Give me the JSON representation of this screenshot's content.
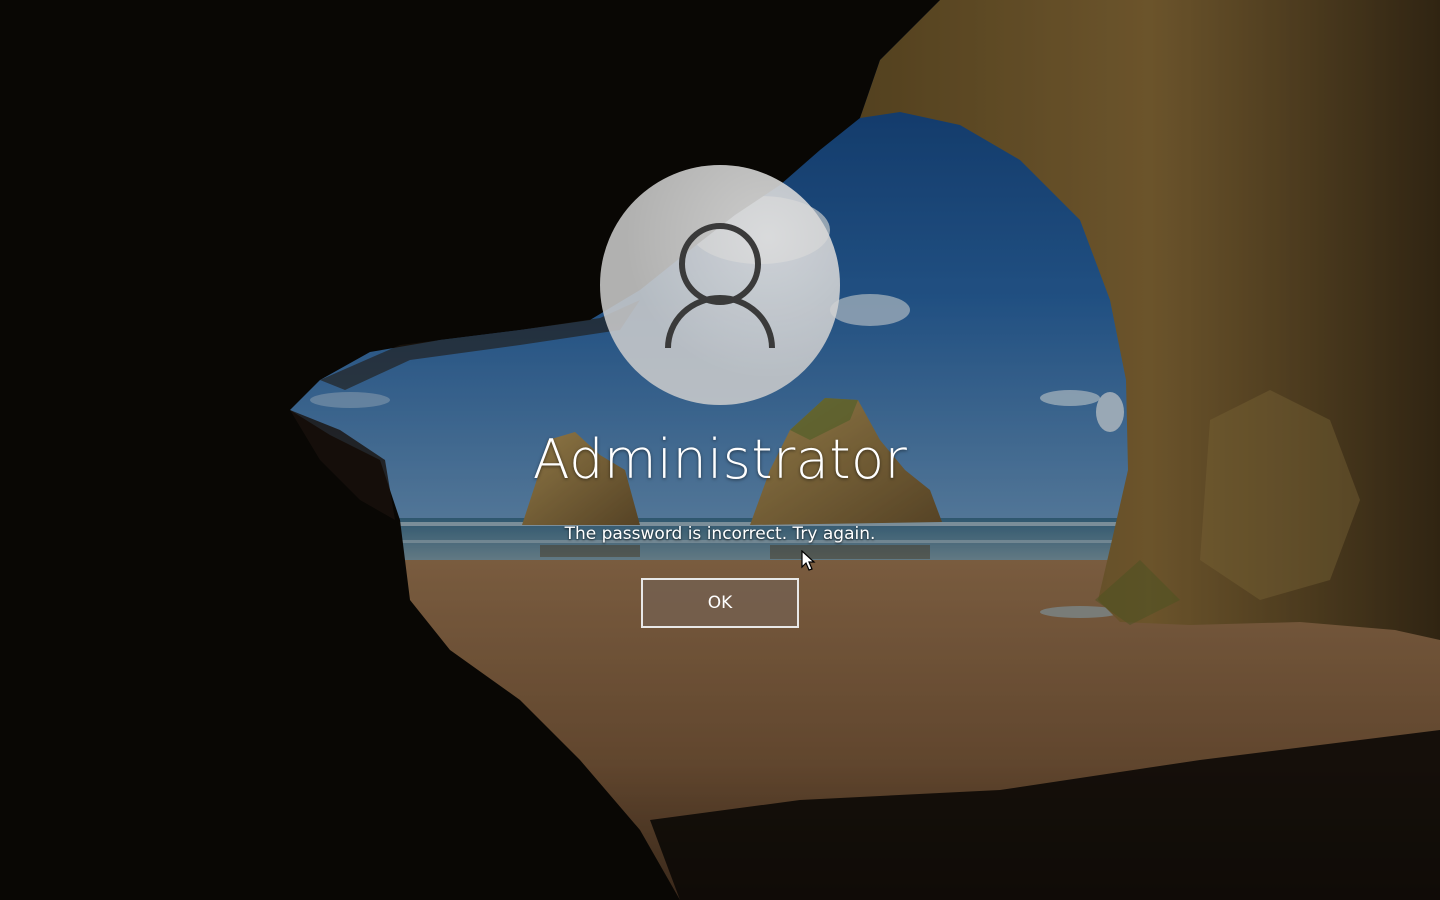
{
  "login": {
    "username": "Administrator",
    "message": "The password is incorrect. Try again.",
    "ok_label": "OK"
  },
  "icons": {
    "avatar": "user-silhouette-icon",
    "cursor": "mouse-pointer-icon"
  },
  "colors": {
    "text": "#ffffff",
    "button_border": "#e8e8e8",
    "button_fill": "#746050",
    "avatar_fill": "#cdcdcd",
    "avatar_outline": "#3a3a3a"
  }
}
